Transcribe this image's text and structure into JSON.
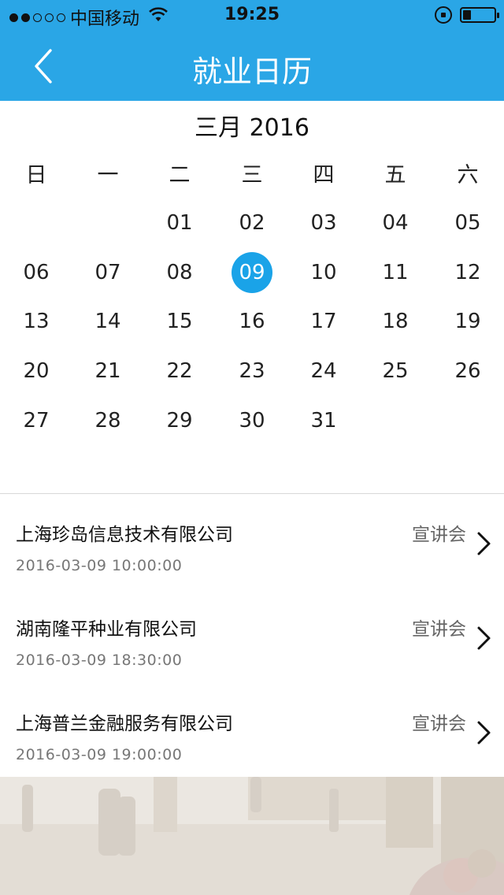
{
  "status": {
    "carrier": "中国移动",
    "time": "19:25"
  },
  "nav": {
    "title": "就业日历"
  },
  "calendar": {
    "month_label": "三月 2016",
    "weekdays": [
      "日",
      "一",
      "二",
      "三",
      "四",
      "五",
      "六"
    ],
    "selected_day": "09",
    "weeks": [
      [
        "",
        "",
        "01",
        "02",
        "03",
        "04",
        "05"
      ],
      [
        "06",
        "07",
        "08",
        "09",
        "10",
        "11",
        "12"
      ],
      [
        "13",
        "14",
        "15",
        "16",
        "17",
        "18",
        "19"
      ],
      [
        "20",
        "21",
        "22",
        "23",
        "24",
        "25",
        "26"
      ],
      [
        "27",
        "28",
        "29",
        "30",
        "31",
        "",
        ""
      ]
    ]
  },
  "events": [
    {
      "company": "上海珍岛信息技术有限公司",
      "type": "宣讲会",
      "datetime": "2016-03-09 10:00:00"
    },
    {
      "company": "湖南隆平种业有限公司",
      "type": "宣讲会",
      "datetime": "2016-03-09 18:30:00"
    },
    {
      "company": "上海普兰金融服务有限公司",
      "type": "宣讲会",
      "datetime": "2016-03-09 19:00:00"
    }
  ],
  "colors": {
    "accent": "#2aa6e6",
    "selected": "#1aa3e8"
  }
}
